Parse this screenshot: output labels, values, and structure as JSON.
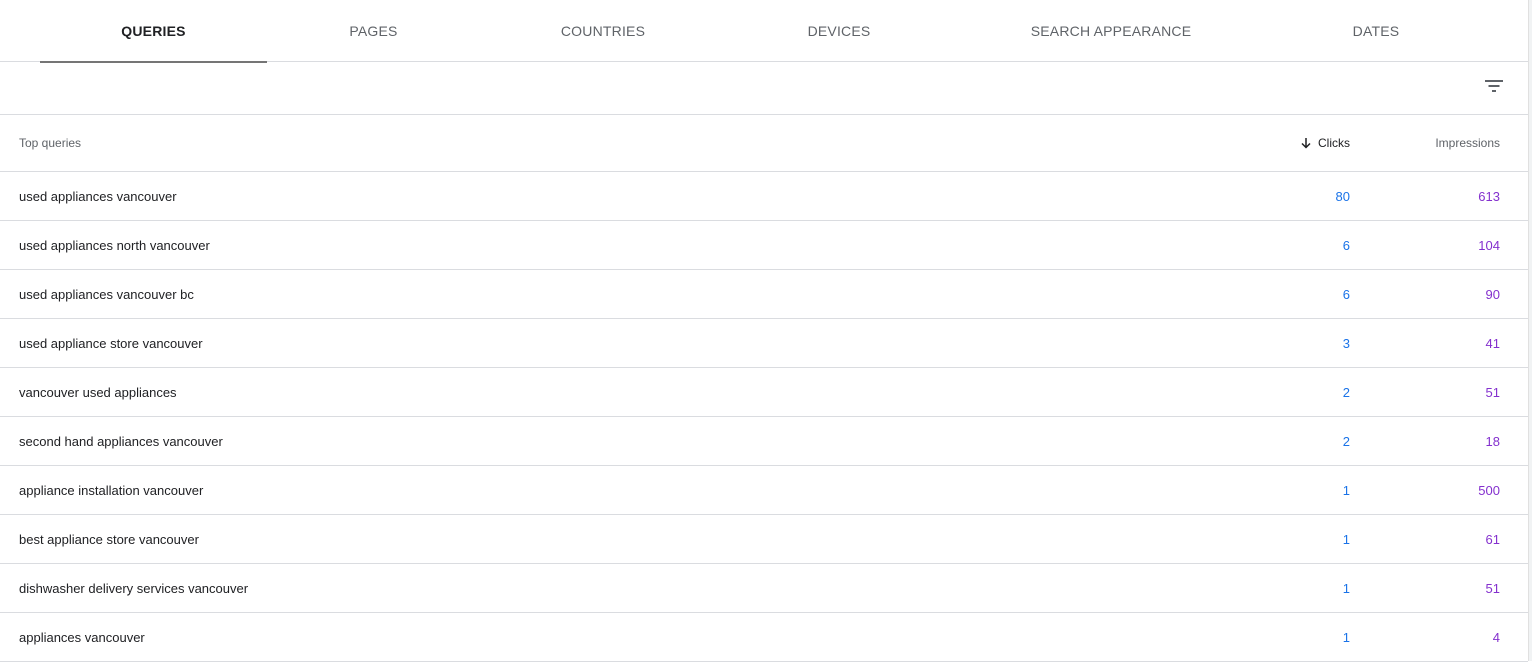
{
  "tabs": [
    {
      "label": "QUERIES",
      "active": true
    },
    {
      "label": "PAGES",
      "active": false
    },
    {
      "label": "COUNTRIES",
      "active": false
    },
    {
      "label": "DEVICES",
      "active": false
    },
    {
      "label": "SEARCH APPEARANCE",
      "active": false
    },
    {
      "label": "DATES",
      "active": false
    }
  ],
  "toolbar": {
    "filter_icon": "filter-list-icon"
  },
  "table": {
    "headers": {
      "query": "Top queries",
      "clicks": "Clicks",
      "impressions": "Impressions",
      "sort_icon": "arrow-down-icon"
    },
    "rows": [
      {
        "query": "used appliances vancouver",
        "clicks": "80",
        "impressions": "613"
      },
      {
        "query": "used appliances north vancouver",
        "clicks": "6",
        "impressions": "104"
      },
      {
        "query": "used appliances vancouver bc",
        "clicks": "6",
        "impressions": "90"
      },
      {
        "query": "used appliance store vancouver",
        "clicks": "3",
        "impressions": "41"
      },
      {
        "query": "vancouver used appliances",
        "clicks": "2",
        "impressions": "51"
      },
      {
        "query": "second hand appliances vancouver",
        "clicks": "2",
        "impressions": "18"
      },
      {
        "query": "appliance installation vancouver",
        "clicks": "1",
        "impressions": "500"
      },
      {
        "query": "best appliance store vancouver",
        "clicks": "1",
        "impressions": "61"
      },
      {
        "query": "dishwasher delivery services vancouver",
        "clicks": "1",
        "impressions": "51"
      },
      {
        "query": "appliances vancouver",
        "clicks": "1",
        "impressions": "4"
      }
    ]
  },
  "colors": {
    "clicks": "#1a73e8",
    "impressions": "#8430ce",
    "active_tab_indicator": "#757575",
    "divider": "#dadce0"
  }
}
